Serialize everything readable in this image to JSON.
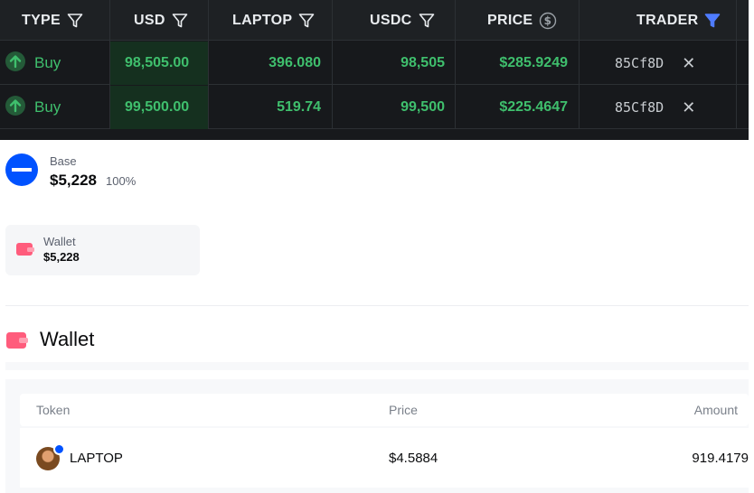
{
  "trades": {
    "headers": {
      "type": "TYPE",
      "usd": "USD",
      "laptop": "LAPTOP",
      "usdc": "USDC",
      "price": "PRICE",
      "trader": "TRADER"
    },
    "rows": [
      {
        "type": "Buy",
        "usd": "98,505.00",
        "laptop": "396.080",
        "usdc": "98,505",
        "price": "$285.9249",
        "trader": "85Cf8D"
      },
      {
        "type": "Buy",
        "usd": "99,500.00",
        "laptop": "519.74",
        "usdc": "99,500",
        "price": "$225.4647",
        "trader": "85Cf8D"
      }
    ],
    "close_glyph": "✕",
    "colors": {
      "buy": "#3fbf6d",
      "active_filter": "#4f7cff"
    }
  },
  "base": {
    "name": "Base",
    "value": "$5,228",
    "percent": "100%",
    "icon": "base-network-icon"
  },
  "wallet_card": {
    "label": "Wallet",
    "value": "$5,228",
    "icon": "wallet-icon"
  },
  "wallet_section": {
    "title": "Wallet",
    "columns": {
      "token": "Token",
      "price": "Price",
      "amount": "Amount"
    },
    "tokens": [
      {
        "name": "LAPTOP",
        "price": "$4.5884",
        "amount": "919.4179"
      }
    ]
  }
}
